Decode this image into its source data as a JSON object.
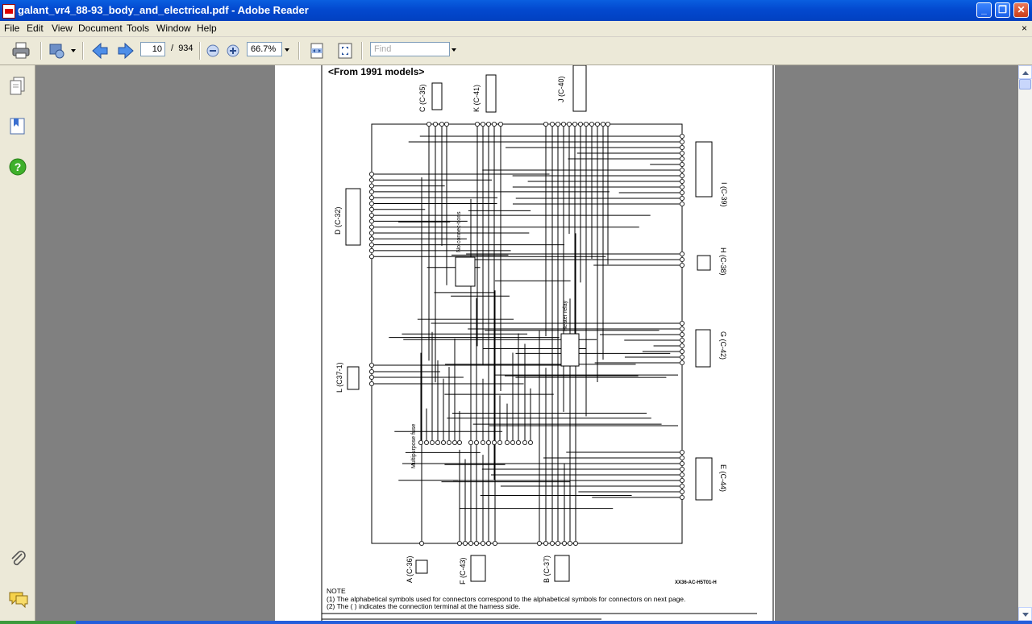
{
  "window": {
    "title": "galant_vr4_88-93_body_and_electrical.pdf - Adobe Reader",
    "minimize": "_",
    "maximize": "❐",
    "close": "✕"
  },
  "menu": {
    "items": [
      "File",
      "Edit",
      "View",
      "Document",
      "Tools",
      "Window",
      "Help"
    ],
    "doc_close": "×"
  },
  "toolbar": {
    "current_page": "10",
    "page_separator": "/",
    "total_pages": "934",
    "zoom": "66.7%",
    "find_placeholder": "Find",
    "icons": [
      "printer-icon",
      "organizer-icon",
      "previous-page-icon",
      "next-page-icon",
      "zoom-out-icon",
      "zoom-in-icon",
      "fit-width-icon",
      "fit-page-icon"
    ]
  },
  "nav_pane": {
    "icons": [
      "pages-icon",
      "bookmarks-icon",
      "help-icon",
      "attachments-icon",
      "comments-icon"
    ]
  },
  "document": {
    "heading": "<From 1991 models>",
    "connectors": {
      "c": "C (C-35)",
      "k": "K (C-41)",
      "j": "J (C-40)",
      "d": "D (C-32)",
      "i": "I (C-39)",
      "h": "H (C-38)",
      "g": "G (C-42)",
      "l": "L (C37-1)",
      "e": "E (C-44)",
      "a": "A (C-36)",
      "f": "F (C-43)",
      "b": "B (C-37)"
    },
    "labels": {
      "no_connections": "No connec-tions",
      "heater_relay": "Heater relay",
      "multipurpose_fuse": "Multipurpose fuse",
      "code": "XX36-AC-H5T01-H"
    },
    "note_title": "NOTE",
    "note_1": "(1) The alphabetical symbols used for connectors correspond to the alphabetical symbols for connectors on next page.",
    "note_2": "(2) The (    ) indicates the connection terminal at the harness side."
  },
  "colors": {
    "titlebar": "#0349cf",
    "chrome": "#ece9d8",
    "workspace": "#808080"
  }
}
